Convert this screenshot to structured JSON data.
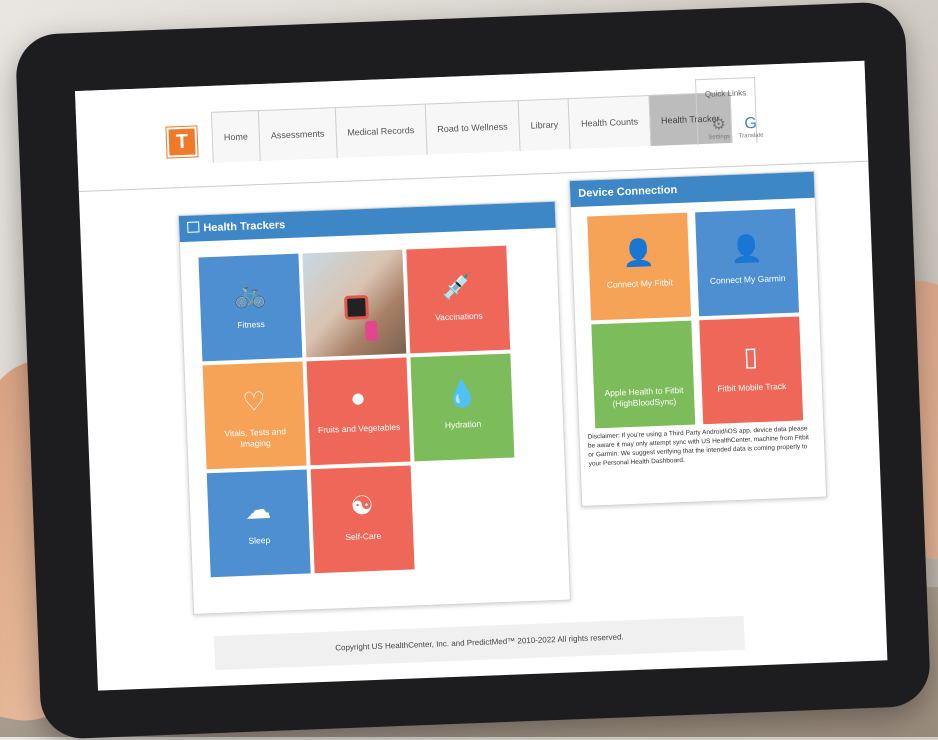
{
  "header": {
    "logo": "T",
    "tabs": [
      {
        "label": "Home"
      },
      {
        "label": "Assessments"
      },
      {
        "label": "Medical Records"
      },
      {
        "label": "Road to Wellness"
      },
      {
        "label": "Library"
      },
      {
        "label": "Health Counts"
      },
      {
        "label": "Health Tracker",
        "active": true
      }
    ],
    "quick_links": "Quick Links",
    "settings_label": "Settings",
    "translate_label": "Translate"
  },
  "health_trackers": {
    "title": "Health Trackers",
    "tiles": [
      {
        "label": "Fitness",
        "color": "#4d8fd1",
        "icon": "bicycle-icon"
      },
      {
        "label": "",
        "color": "#a87f66",
        "icon": "fitness-photo"
      },
      {
        "label": "Vaccinations",
        "color": "#ef6758",
        "icon": "syringe-icon"
      },
      {
        "label": "Vitals, Tests and Imaging",
        "color": "#f6a358",
        "icon": "heartbeat-icon"
      },
      {
        "label": "Fruits and Vegetables",
        "color": "#ef6758",
        "icon": "apple-icon"
      },
      {
        "label": "Hydration",
        "color": "#7cbc5a",
        "icon": "water-drop-icon"
      },
      {
        "label": "Sleep",
        "color": "#4d8fd1",
        "icon": "sleep-icon"
      },
      {
        "label": "Self-Care",
        "color": "#ef6758",
        "icon": "meditation-icon"
      }
    ]
  },
  "device_connection": {
    "title": "Device Connection",
    "tiles": [
      {
        "label": "Connect My Fitbit",
        "color": "#f6a358",
        "icon": "add-user-icon"
      },
      {
        "label": "Connect My Garmin",
        "color": "#4d8fd1",
        "icon": "add-user-icon"
      },
      {
        "label": "Apple Health to Fitbit (HighBloodSync)",
        "color": "#7cbc5a",
        "icon": "apple-logo-icon"
      },
      {
        "label": "Fitbit Mobile Track",
        "color": "#ef6758",
        "icon": "mobile-phone-icon"
      }
    ],
    "disclaimer": "Disclaimer: If you're using a Third Party Android/iOS app, device data please be aware it may only attempt sync with US HealthCenter, machine from Fitbit or Garmin. We suggest verifying that the intended data is coming properly to your Personal Health Dashboard."
  },
  "footer": {
    "copyright": "Copyright US HealthCenter, Inc. and PredictMed™ 2010-2022 All rights reserved."
  }
}
